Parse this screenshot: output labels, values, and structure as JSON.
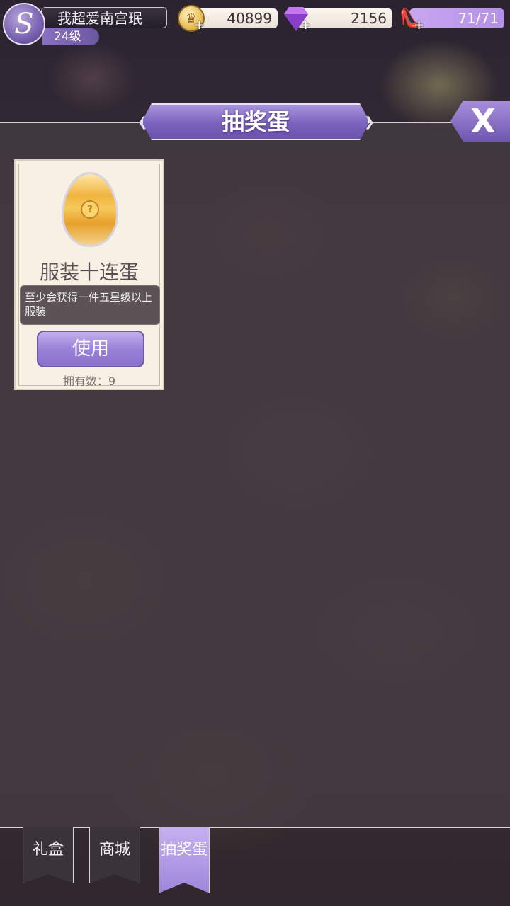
{
  "player": {
    "avatar_letter": "S",
    "name": "我超爱南宫珉",
    "level": "24级"
  },
  "resources": {
    "coins": "40899",
    "gems": "2156",
    "stamina": "71/71",
    "coin_icon": "crown-coin-icon",
    "gem_icon": "diamond-icon",
    "stamina_icon": "glass-slipper-icon",
    "plus": "+"
  },
  "header": {
    "title": "抽奖蛋",
    "close_label": "X",
    "ornament_left": "❮",
    "ornament_right": "❯"
  },
  "items": [
    {
      "name": "服装十连蛋",
      "description": "至少会获得一件五星级以上服装",
      "use_label": "使用",
      "owned": "拥有数：9",
      "egg_symbol": "?"
    }
  ],
  "tabs": [
    {
      "label": "礼盒",
      "active": false
    },
    {
      "label": "商城",
      "active": false
    },
    {
      "label": "抽奖蛋",
      "active": true
    }
  ],
  "colors": {
    "accent": "#9a82d8",
    "panel": "#463e44",
    "card": "#f7f1e4"
  }
}
